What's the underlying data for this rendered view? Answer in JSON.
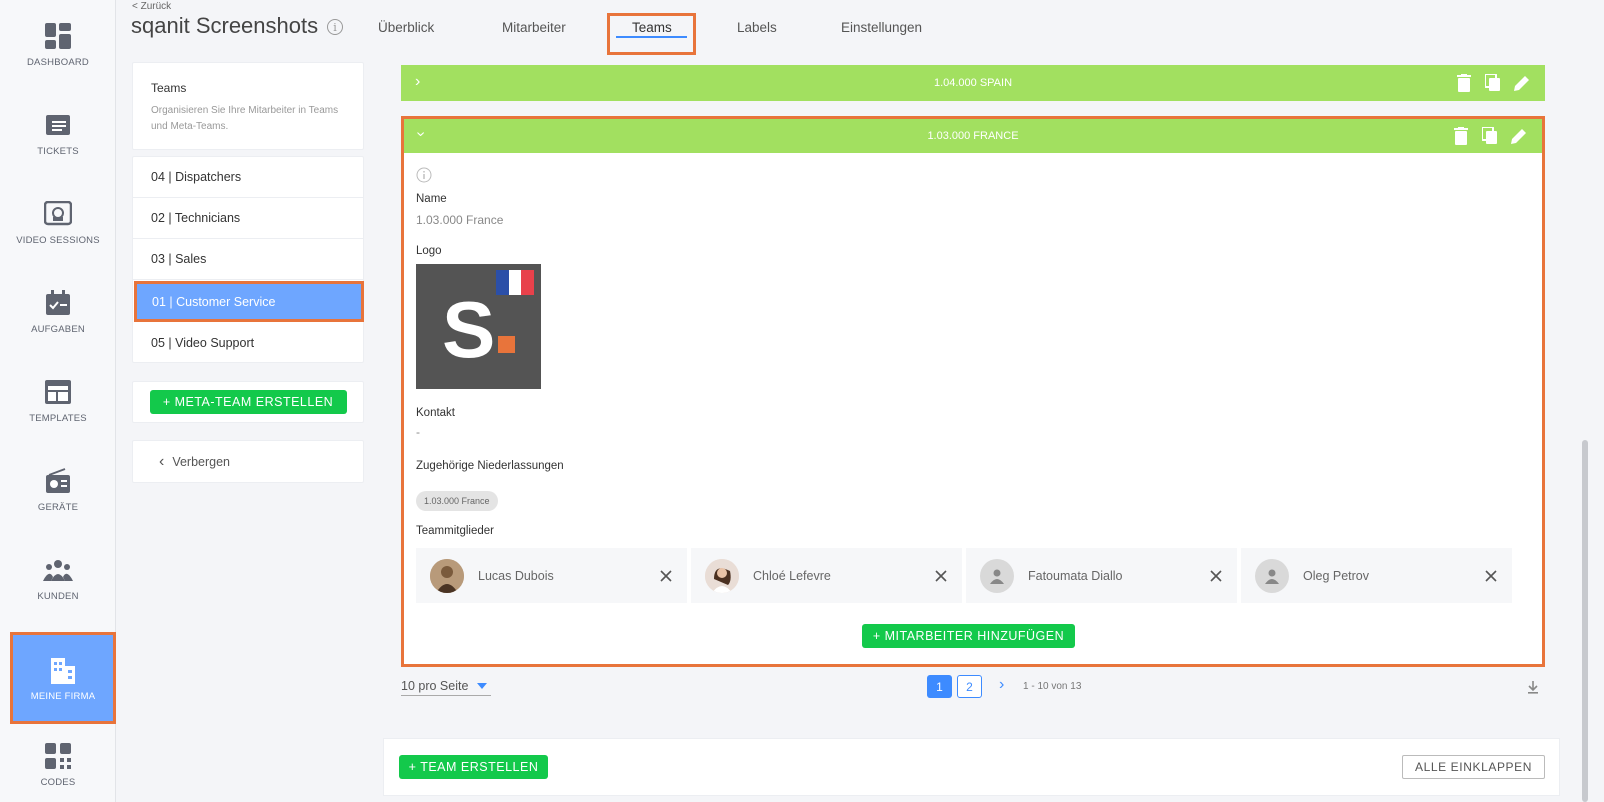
{
  "nav": {
    "items": [
      {
        "label": "DASHBOARD",
        "icon": "dashboard-icon"
      },
      {
        "label": "TICKETS",
        "icon": "ticket-icon"
      },
      {
        "label": "VIDEO SESSIONS",
        "icon": "video-session-icon"
      },
      {
        "label": "AUFGABEN",
        "icon": "calendar-check-icon"
      },
      {
        "label": "TEMPLATES",
        "icon": "template-icon"
      },
      {
        "label": "GERÄTE",
        "icon": "radio-icon"
      },
      {
        "label": "KUNDEN",
        "icon": "people-icon"
      },
      {
        "label": "MEINE FIRMA",
        "icon": "building-icon"
      },
      {
        "label": "CODES",
        "icon": "qr-code-icon"
      }
    ],
    "active": "MEINE FIRMA"
  },
  "header": {
    "back": "< Zurück",
    "title": "sqanit Screenshots",
    "info_glyph": "i",
    "tabs": [
      "Überblick",
      "Mitarbeiter",
      "Teams",
      "Labels",
      "Einstellungen"
    ],
    "active_tab": "Teams"
  },
  "sidebar": {
    "info_title": "Teams",
    "info_text": "Organisieren Sie Ihre Mitarbeiter in Teams und Meta-Teams.",
    "teams": [
      "04 | Dispatchers",
      "02 | Technicians",
      "03 | Sales",
      "01 | Customer Service",
      "05 | Video Support"
    ],
    "selected_team": "01 | Customer Service",
    "meta_button": "+ META-TEAM ERSTELLEN",
    "hide_label": "Verbergen"
  },
  "main": {
    "collapsed_team": "1.04.000 SPAIN",
    "expanded_team": "1.03.000 FRANCE",
    "fields": {
      "name_label": "Name",
      "name_value": "1.03.000 France",
      "logo_label": "Logo",
      "logo_letter": "S",
      "contact_label": "Kontakt",
      "contact_value": "-",
      "branches_label": "Zugehörige Niederlassungen",
      "branch_chip": "1.03.000 France",
      "members_label": "Teammitglieder"
    },
    "members": [
      {
        "name": "Lucas Dubois",
        "avatar": "photo"
      },
      {
        "name": "Chloé Lefevre",
        "avatar": "photo"
      },
      {
        "name": "Fatoumata Diallo",
        "avatar": "placeholder"
      },
      {
        "name": "Oleg Petrov",
        "avatar": "placeholder"
      }
    ],
    "add_member_button": "+ MITARBEITER HINZUFÜGEN"
  },
  "pagination": {
    "per_page": "10 pro Seite",
    "pages": [
      "1",
      "2"
    ],
    "current_page": "1",
    "range": "1 - 10 von 13"
  },
  "footer": {
    "create_team": "+ TEAM ERSTELLEN",
    "collapse_all": "ALLE EINKLAPPEN"
  },
  "colors": {
    "accent_blue": "#3d8bff",
    "active_blue": "#6ea6ff",
    "team_bar_green": "#a2e060",
    "button_green": "#13c94b",
    "highlight_orange": "#e8743b"
  }
}
